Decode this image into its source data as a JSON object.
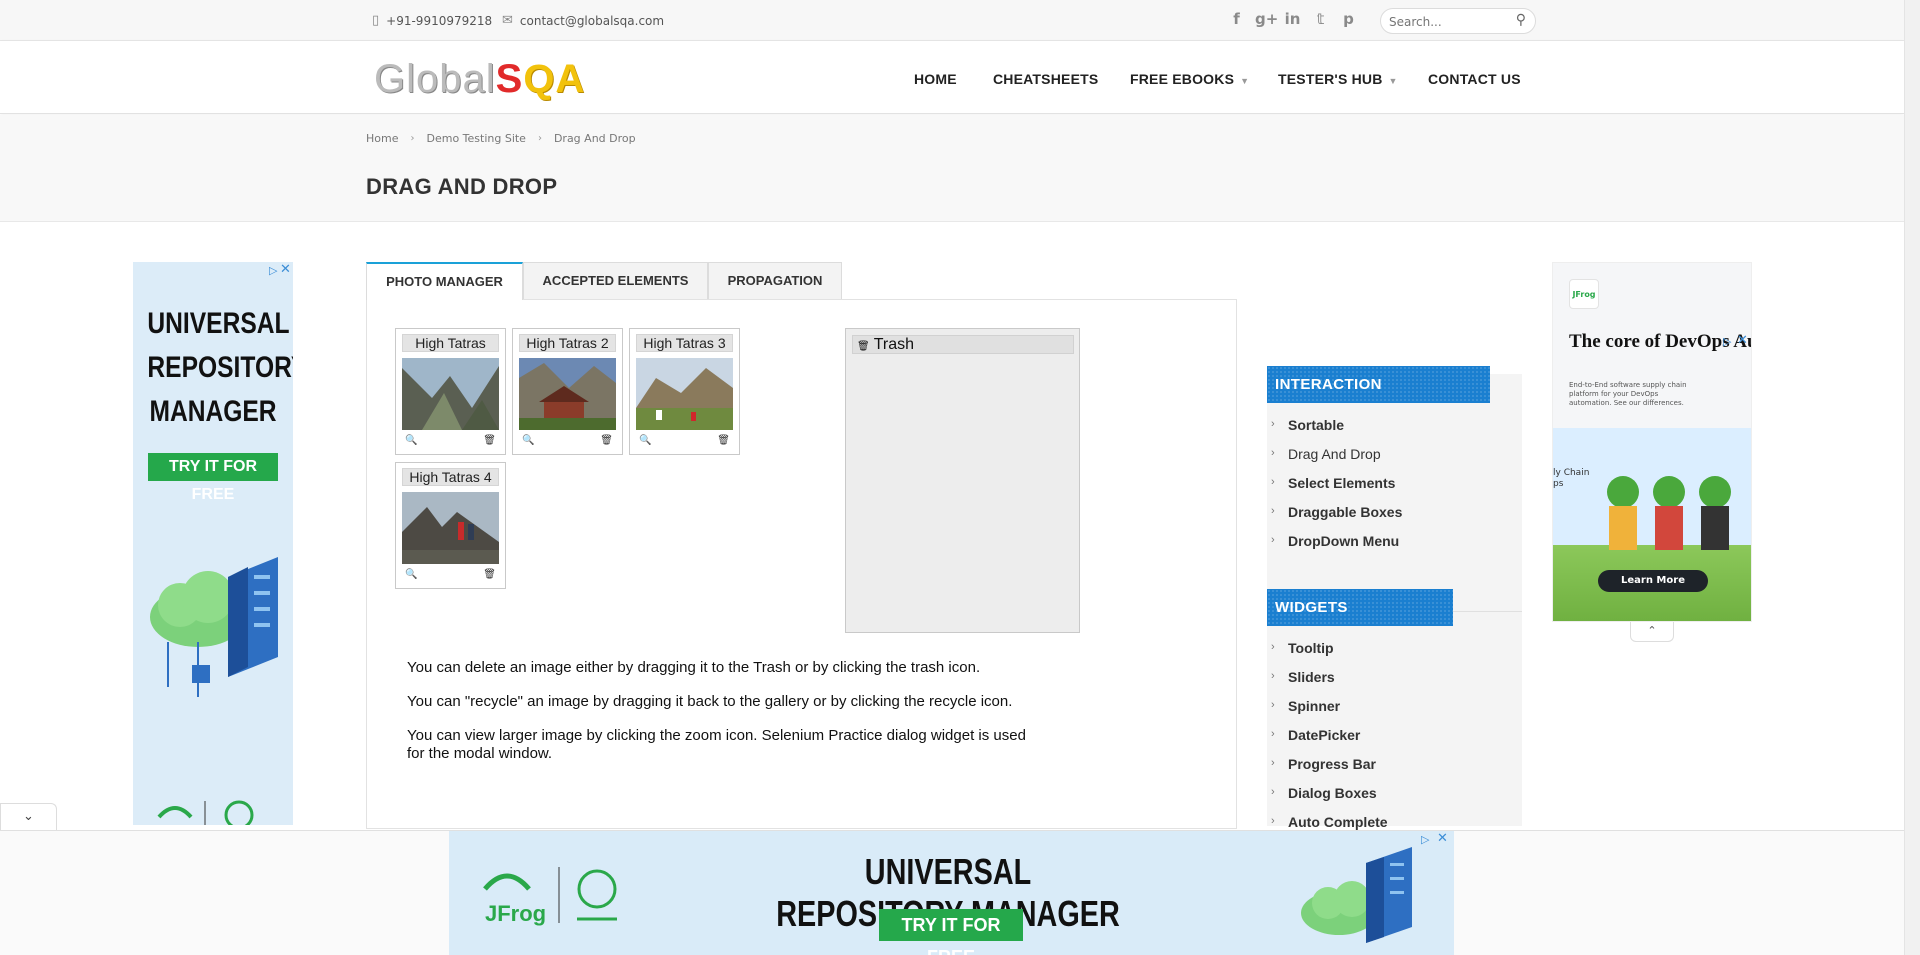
{
  "topbar": {
    "phone": "+91-9910979218",
    "email": "contact@globalsqa.com",
    "search_placeholder": "Search..."
  },
  "header": {
    "logo_global": "Global",
    "logo_s": "S",
    "logo_qa": "QA",
    "nav": [
      "HOME",
      "CHEATSHEETS",
      "FREE EBOOKS",
      "TESTER'S HUB",
      "CONTACT US"
    ]
  },
  "breadcrumb": [
    "Home",
    "Demo Testing Site",
    "Drag And Drop"
  ],
  "page_title": "DRAG AND DROP",
  "tabs": [
    "PHOTO MANAGER",
    "ACCEPTED ELEMENTS",
    "PROPAGATION"
  ],
  "gallery": [
    {
      "title": "High Tatras"
    },
    {
      "title": "High Tatras 2"
    },
    {
      "title": "High Tatras 3"
    },
    {
      "title": "High Tatras 4"
    }
  ],
  "trash_title": "Trash",
  "info": [
    "You can delete an image either by dragging it to the Trash or by clicking the trash icon.",
    "You can \"recycle\" an image by dragging it back to the gallery or by clicking the recycle icon.",
    "You can view larger image by clicking the zoom icon. Selenium Practice dialog widget is used for the modal window."
  ],
  "sidebar": {
    "interaction_title": "INTERACTION",
    "interaction": [
      "Sortable",
      "Drag And Drop",
      "Select Elements",
      "Draggable Boxes",
      "DropDown Menu"
    ],
    "widgets_title": "WIDGETS",
    "widgets": [
      "Tooltip",
      "Sliders",
      "Spinner",
      "DatePicker",
      "Progress Bar",
      "Dialog Boxes",
      "Auto Complete"
    ]
  },
  "ads": {
    "left_title_1": "UNIVERSAL",
    "left_title_2": "REPOSITORY",
    "left_title_3": "MANAGER",
    "left_button": "TRY IT FOR FREE",
    "right_brand": "JFrog",
    "right_headline": "The core of DevOps Automation",
    "right_sub": "End-to-End software supply chain platform for your DevOps automation. See our differences.",
    "right_side_text": "ly Chain\nps",
    "right_button": "Learn More",
    "bottom_title": "UNIVERSAL REPOSITORY MANAGER",
    "bottom_button": "TRY IT FOR FREE",
    "bottom_brand": "JFrog"
  },
  "colors": {
    "accent": "#1aa1d8",
    "sidebar_head": "#1a7fd0",
    "ad_green": "#25a84b",
    "ad_bg": "#d9ebf8"
  }
}
